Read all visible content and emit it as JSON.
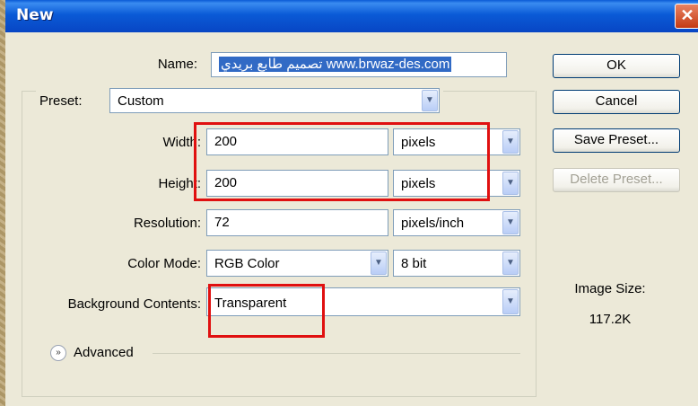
{
  "dialog": {
    "title": "New",
    "close_glyph": "✕",
    "name_label": "Name:",
    "name_value": "تصميم طابع بريدي www.brwaz-des.com",
    "preset_label": "Preset:",
    "preset_value": "Custom",
    "width_label": "Width:",
    "width_value": "200",
    "width_unit": "pixels",
    "height_label": "Height:",
    "height_value": "200",
    "height_unit": "pixels",
    "resolution_label": "Resolution:",
    "resolution_value": "72",
    "resolution_unit": "pixels/inch",
    "color_mode_label": "Color Mode:",
    "color_mode_value": "RGB Color",
    "bit_depth_value": "8 bit",
    "background_label": "Background Contents:",
    "background_value": "Transparent",
    "advanced_label": "Advanced",
    "advanced_glyph": "»",
    "dropdown_glyph": "▼"
  },
  "buttons": {
    "ok": "OK",
    "cancel": "Cancel",
    "save_preset": "Save Preset...",
    "delete_preset": "Delete Preset..."
  },
  "image_size": {
    "label": "Image Size:",
    "value": "117.2K"
  },
  "colors": {
    "titlebar": "#0a5ad6",
    "highlight_box": "#e01010",
    "dialog_bg": "#ece9d8",
    "selection": "#316ac5"
  }
}
